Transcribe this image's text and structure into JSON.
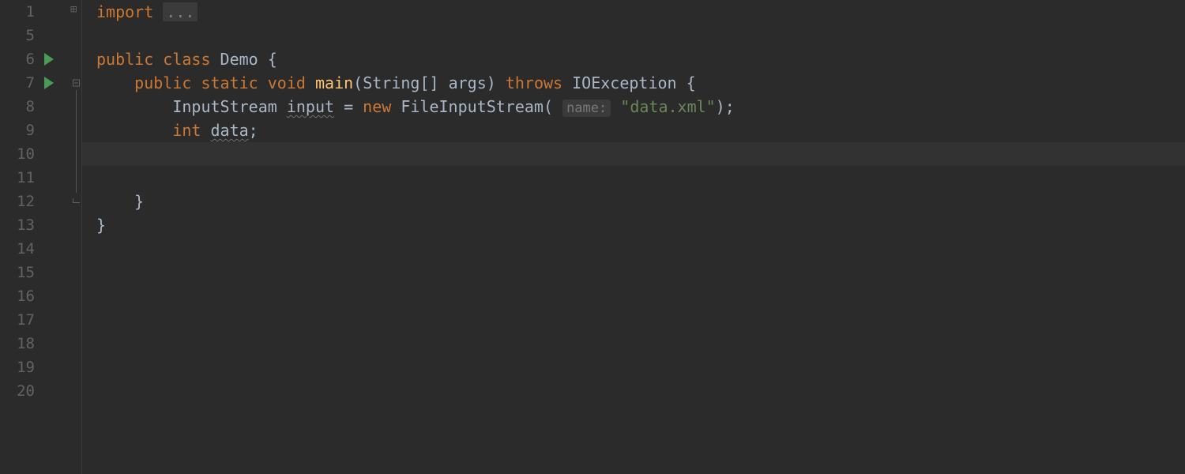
{
  "gutter": {
    "lines": [
      "1",
      "5",
      "6",
      "7",
      "8",
      "9",
      "10",
      "11",
      "12",
      "13",
      "14",
      "15",
      "16",
      "17",
      "18",
      "19",
      "20"
    ]
  },
  "code": {
    "line1": {
      "import_kw": "import",
      "folded": "..."
    },
    "line6": {
      "public_kw": "public ",
      "class_kw": "class ",
      "classname": "Demo ",
      "brace": "{"
    },
    "line7": {
      "public_kw": "public ",
      "static_kw": "static ",
      "void_kw": "void ",
      "method": "main",
      "lparen": "(",
      "argtype": "String",
      "brackets": "[] ",
      "argname": "args",
      "rparen": ") ",
      "throws_kw": "throws ",
      "exc": "IOException ",
      "brace": "{"
    },
    "line8": {
      "type": "InputStream ",
      "var": "input",
      "assign": " = ",
      "new_kw": "new ",
      "ctor": "FileInputStream",
      "lparen": "( ",
      "hint": "name:",
      "str": " \"data.xml\"",
      "rparen_semi": ");"
    },
    "line9": {
      "int_kw": "int ",
      "var": "data",
      "semi": ";"
    },
    "line12": {
      "brace": "}"
    },
    "line13": {
      "brace": "}"
    }
  }
}
